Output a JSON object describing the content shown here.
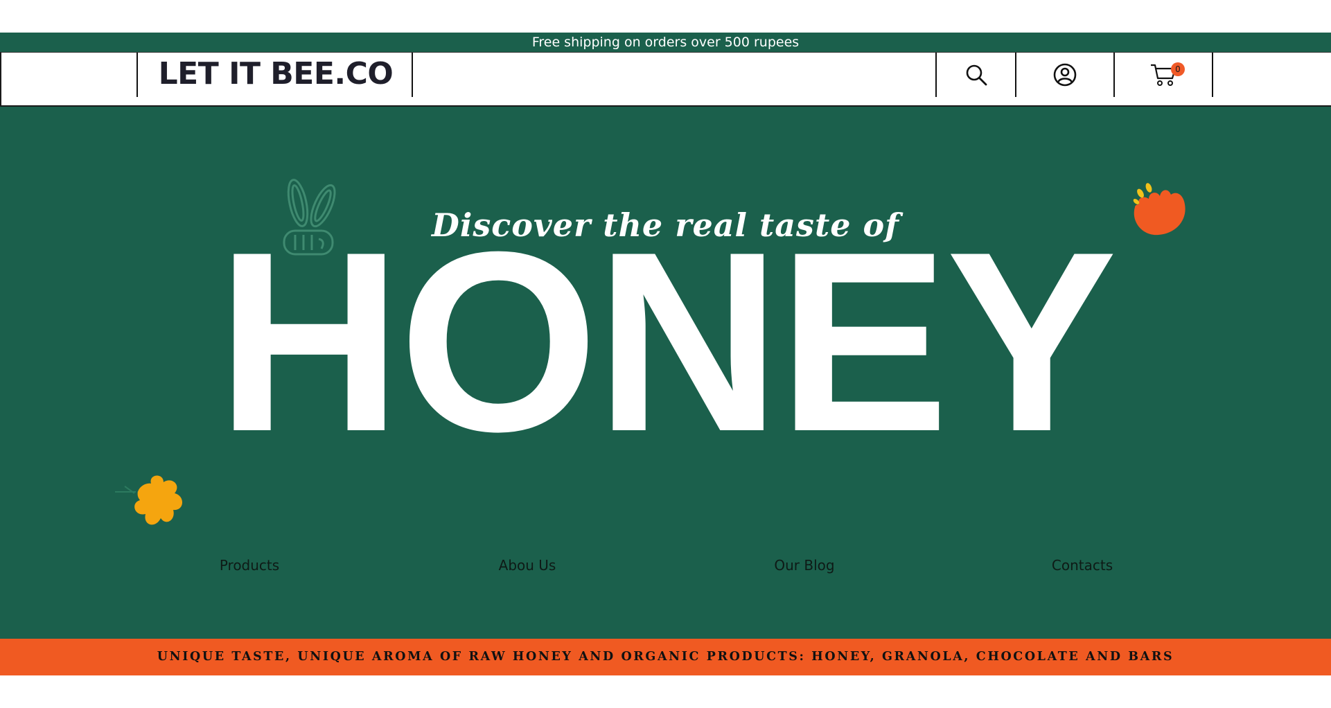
{
  "promo": {
    "text": "Free shipping on orders over 500 rupees"
  },
  "header": {
    "logo": "LET IT BEE.CO",
    "cart_count": "0",
    "icons": {
      "search": "search-icon",
      "account": "user-circle-icon",
      "cart": "cart-icon"
    }
  },
  "hero": {
    "tagline": "Discover the real taste of",
    "title": "HONEY",
    "decorations": [
      "bee-outline-icon",
      "orange-flower-icon",
      "yellow-flower-icon"
    ],
    "colors": {
      "background": "#1b604c",
      "accent_orange": "#f05a22",
      "accent_yellow": "#f5a50f"
    }
  },
  "nav": {
    "items": [
      {
        "label": "Products"
      },
      {
        "label": "Abou Us"
      },
      {
        "label": "Our Blog"
      },
      {
        "label": "Contacts"
      }
    ]
  },
  "ticker": {
    "text": "UNIQUE TASTE, UNIQUE AROMA OF RAW HONEY AND ORGANIC PRODUCTS: HONEY, GRANOLA, CHOCOLATE AND BARS"
  }
}
